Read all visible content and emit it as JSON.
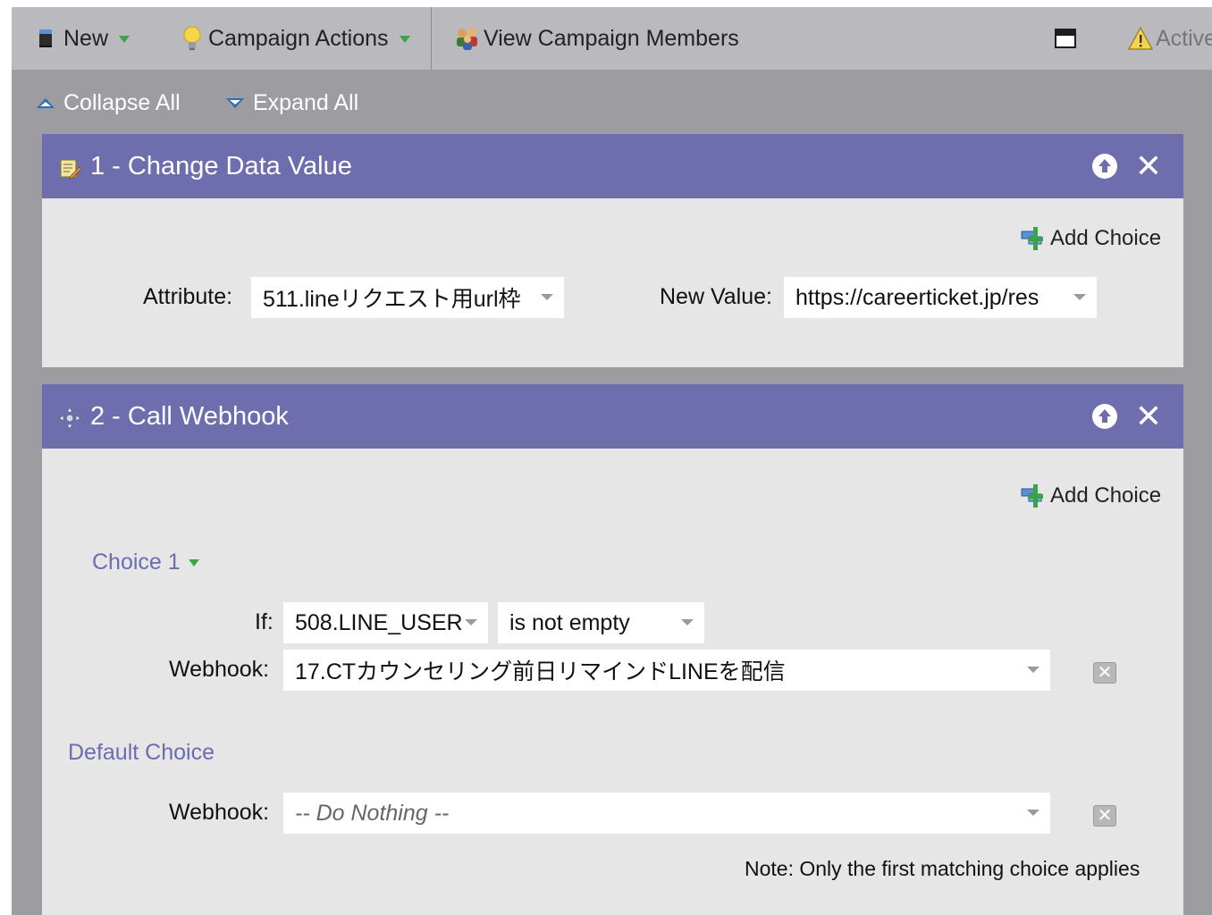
{
  "toolbar": {
    "new_label": "New",
    "campaign_actions_label": "Campaign Actions",
    "view_members_label": "View Campaign Members",
    "active_label": "Active"
  },
  "view_controls": {
    "collapse_all": "Collapse All",
    "expand_all": "Expand All"
  },
  "step1": {
    "title": "1 - Change Data Value",
    "add_choice": "Add Choice",
    "attribute_label": "Attribute:",
    "attribute_value": "511.lineリクエスト用url枠",
    "new_value_label": "New Value:",
    "new_value": "https://careerticket.jp/res"
  },
  "step2": {
    "title": "2 - Call Webhook",
    "add_choice": "Add Choice",
    "choice1": {
      "heading": "Choice 1",
      "if_label": "If:",
      "if_field": "508.LINE_USER",
      "if_operator": "is not empty",
      "webhook_label": "Webhook:",
      "webhook_value": "17.CTカウンセリング前日リマインドLINEを配信"
    },
    "default_choice": {
      "heading": "Default Choice",
      "webhook_label": "Webhook:",
      "webhook_value": "-- Do Nothing --"
    },
    "note": "Note: Only the first matching choice applies"
  },
  "colors": {
    "panel_header": "#6e6dad",
    "panel_body": "#e6e6e6",
    "toolbar": "#b9b9be",
    "workspace": "#9c9ca1",
    "choice_text": "#6c6cb0"
  }
}
